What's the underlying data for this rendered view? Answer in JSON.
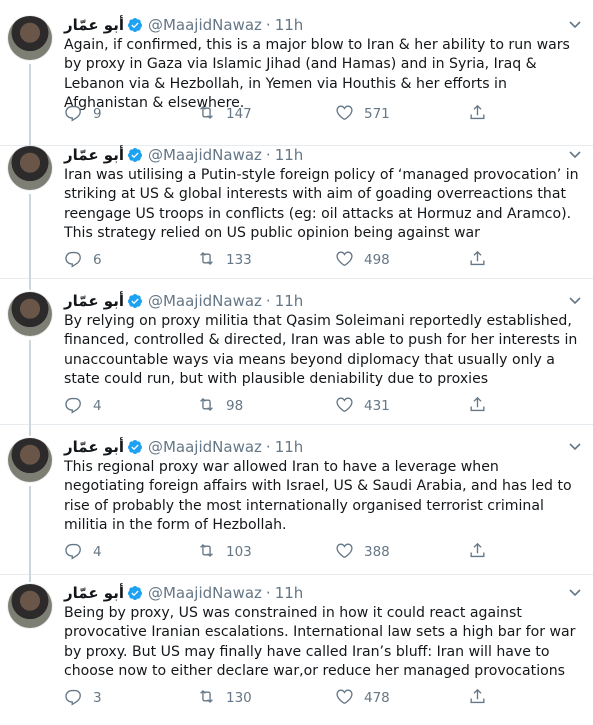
{
  "tweets": [
    {
      "name": "أبو عمّار",
      "handle": "@MaajidNawaz",
      "time": "11h",
      "text": "Again, if confirmed, this is a major blow to Iran & her ability to run wars by proxy in Gaza via Islamic Jihad (and Hamas) and in Syria, Iraq & Lebanon via & Hezbollah, in Yemen via Houthis & her efforts in Afghanistan & elsewhere.",
      "replies": "9",
      "retweets": "147",
      "likes": "571"
    },
    {
      "name": "أبو عمّار",
      "handle": "@MaajidNawaz",
      "time": "11h",
      "text": "Iran was utilising a Putin-style foreign policy of ‘managed provocation’ in striking at US & global interests with aim of goading overreactions that reengage US troops in conflicts (eg: oil attacks at Hormuz and Aramco). This strategy relied on US public opinion being against war",
      "replies": "6",
      "retweets": "133",
      "likes": "498"
    },
    {
      "name": "أبو عمّار",
      "handle": "@MaajidNawaz",
      "time": "11h",
      "text": "By relying on proxy militia that Qasim Soleimani reportedly established, financed, controlled & directed, Iran was able to push for her interests in unaccountable ways via means beyond diplomacy that usually only a state could run, but with plausible deniability due to proxies",
      "replies": "4",
      "retweets": "98",
      "likes": "431"
    },
    {
      "name": "أبو عمّار",
      "handle": "@MaajidNawaz",
      "time": "11h",
      "text": "This regional proxy war allowed Iran to have a leverage when negotiating foreign affairs with Israel, US & Saudi Arabia, and has led to rise of probably the most internationally organised terrorist criminal militia in the form of Hezbollah.",
      "replies": "4",
      "retweets": "103",
      "likes": "388"
    },
    {
      "name": "أبو عمّار",
      "handle": "@MaajidNawaz",
      "time": "11h",
      "text": "Being by proxy, US was constrained in how it could react against provocative Iranian escalations. International law sets a high bar for war by proxy. But US may finally have called Iran’s bluff: Iran will have to choose now to either declare war,or reduce her managed provocations",
      "replies": "3",
      "retweets": "130",
      "likes": "478"
    }
  ],
  "icons": {
    "verified": "verified-badge-icon",
    "caret": "chevron-down-icon",
    "reply": "reply-icon",
    "retweet": "retweet-icon",
    "like": "heart-icon",
    "share": "share-icon"
  },
  "colors": {
    "verified": "#1da1f2",
    "secondary_text": "#657786",
    "divider": "#e6ecf0",
    "thread_line": "#ccd6dd"
  }
}
